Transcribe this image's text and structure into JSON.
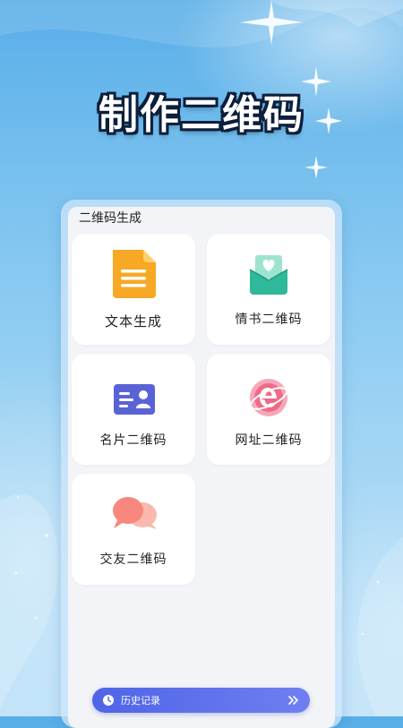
{
  "hero": {
    "title": "制作二维码"
  },
  "panel": {
    "header": "二维码生成"
  },
  "cards": [
    {
      "label": "文本生成",
      "icon": "document-icon"
    },
    {
      "label": "情书二维码",
      "icon": "love-letter-icon"
    },
    {
      "label": "名片二维码",
      "icon": "business-card-icon"
    },
    {
      "label": "网址二维码",
      "icon": "web-browser-icon"
    },
    {
      "label": "交友二维码",
      "icon": "chat-bubbles-icon"
    }
  ],
  "history": {
    "label": "历史记录",
    "icon": "clock-icon",
    "arrow_icon": "double-chevron-right-icon"
  },
  "colors": {
    "document": "#f7a825",
    "love_letter": "#2fb89a",
    "business_card": "#5a63d6",
    "web": "#f06a8a",
    "chat": "#f7877f",
    "history_bar": "#5568ea"
  }
}
